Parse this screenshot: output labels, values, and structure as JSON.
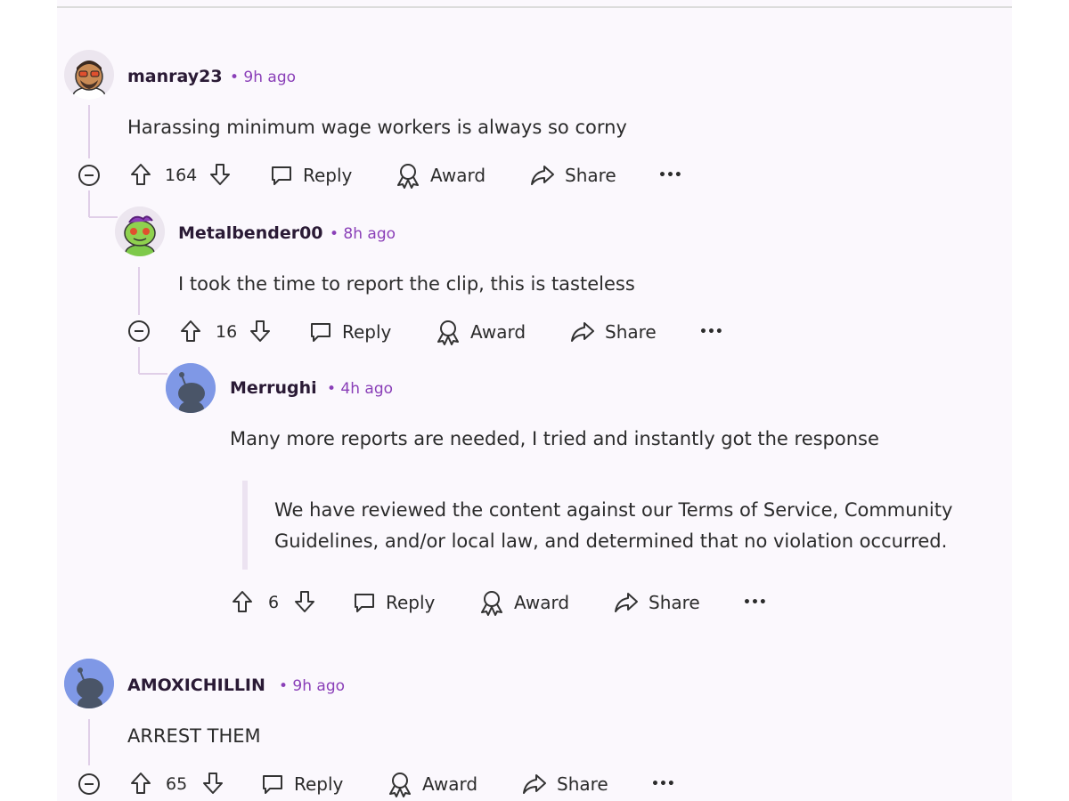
{
  "comments": [
    {
      "username": "manray23",
      "time": "• 9h ago",
      "body": "Harassing minimum wage workers is always so corny",
      "votes": "164",
      "actions": {
        "reply": "Reply",
        "award": "Award",
        "share": "Share",
        "more": "•••"
      }
    },
    {
      "username": "Metalbender00",
      "time": "• 8h ago",
      "body": "I took the time to report the clip, this is tasteless",
      "votes": "16",
      "actions": {
        "reply": "Reply",
        "award": "Award",
        "share": "Share",
        "more": "•••"
      }
    },
    {
      "username": "Merrughi",
      "time": "• 4h ago",
      "body": "Many more reports are needed, I tried and instantly got the response",
      "quote_lines": [
        "We have reviewed the content against our Terms of Service, Community",
        "Guidelines, and/or local law, and determined that no violation occurred."
      ],
      "votes": "6",
      "actions": {
        "reply": "Reply",
        "award": "Award",
        "share": "Share",
        "more": "•••"
      }
    },
    {
      "username": "AMOXICHILLIN",
      "time": "• 9h ago",
      "body": "ARREST THEM",
      "votes": "65",
      "actions": {
        "reply": "Reply",
        "award": "Award",
        "share": "Share",
        "more": "•••"
      }
    }
  ],
  "colors": {
    "time": "#8a3fb8",
    "thread_line": "#e0cfe8",
    "quote_bar": "#ece3f1",
    "avatar_blue": "#7f98e6"
  }
}
